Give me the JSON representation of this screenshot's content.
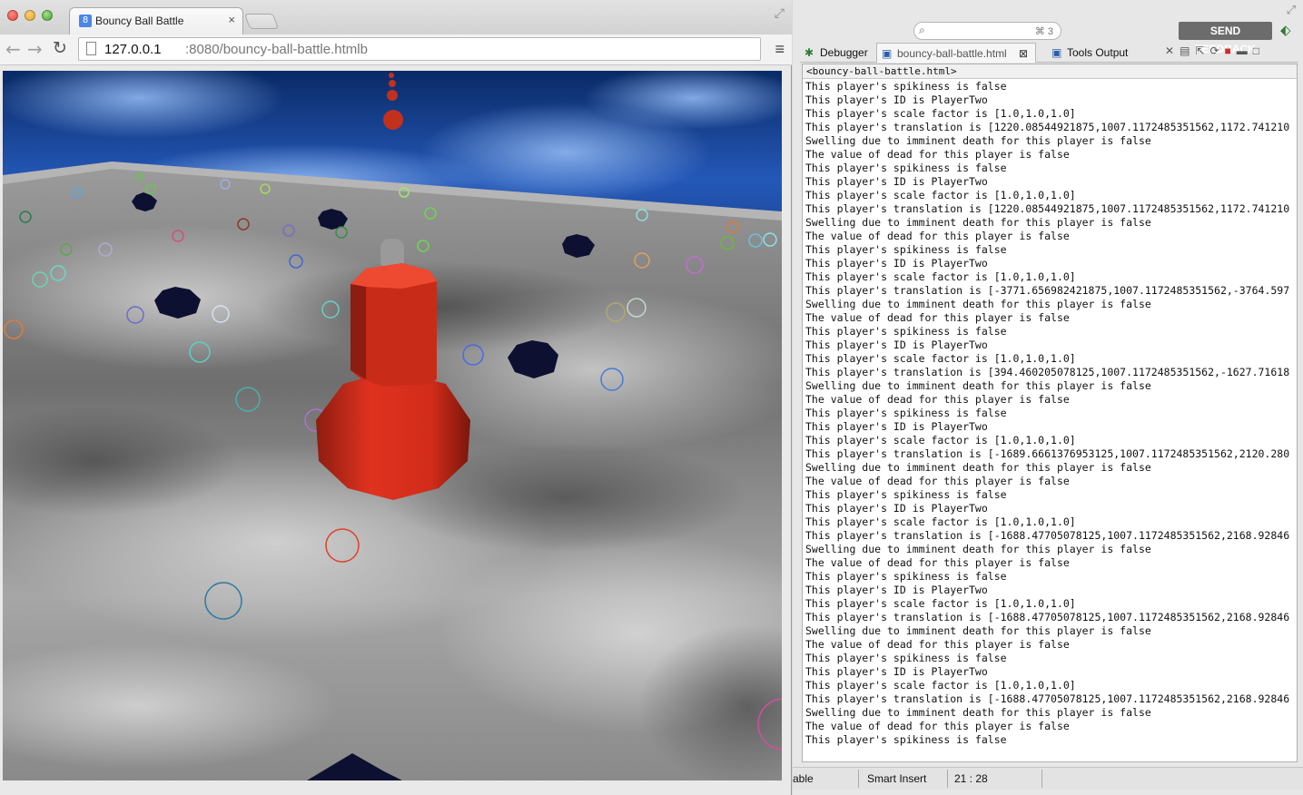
{
  "browser": {
    "tab_title": "Bouncy Ball Battle",
    "tab_favicon": "8",
    "tab_close": "×",
    "url_host": "127.0.0.1",
    "url_path": ":8080/bouncy-ball-battle.htmlb",
    "icons": {
      "back": "←",
      "forward": "→",
      "reload": "↻",
      "menu": "≡",
      "fullscreen": "⤢"
    }
  },
  "ide": {
    "search_placeholder": "",
    "search_hint": "⌘ 3",
    "feedback_label": "SEND FEEDBACK",
    "tabs": [
      {
        "label": "Debugger",
        "icon": "bug-icon"
      },
      {
        "label": "bouncy-ball-battle.html",
        "icon": "file-icon"
      },
      {
        "label": "Tools Output",
        "icon": "console-icon"
      }
    ],
    "editor_tab_close": "⊠",
    "console_header": "<bouncy-ball-battle.html>",
    "console_lines": [
      "This player's spikiness is false",
      "This player's ID is PlayerTwo",
      "This player's scale factor is [1.0,1.0,1.0]",
      "This player's translation is [1220.08544921875,1007.1172485351562,1172.741210",
      "Swelling due to imminent death for this player is false",
      "The value of dead for this player is false",
      "This player's spikiness is false",
      "This player's ID is PlayerTwo",
      "This player's scale factor is [1.0,1.0,1.0]",
      "This player's translation is [1220.08544921875,1007.1172485351562,1172.741210",
      "Swelling due to imminent death for this player is false",
      "The value of dead for this player is false",
      "This player's spikiness is false",
      "This player's ID is PlayerTwo",
      "This player's scale factor is [1.0,1.0,1.0]",
      "This player's translation is [-3771.656982421875,1007.1172485351562,-3764.597",
      "Swelling due to imminent death for this player is false",
      "The value of dead for this player is false",
      "This player's spikiness is false",
      "This player's ID is PlayerTwo",
      "This player's scale factor is [1.0,1.0,1.0]",
      "This player's translation is [394.460205078125,1007.1172485351562,-1627.71618",
      "Swelling due to imminent death for this player is false",
      "The value of dead for this player is false",
      "This player's spikiness is false",
      "This player's ID is PlayerTwo",
      "This player's scale factor is [1.0,1.0,1.0]",
      "This player's translation is [-1689.6661376953125,1007.1172485351562,2120.280",
      "Swelling due to imminent death for this player is false",
      "The value of dead for this player is false",
      "This player's spikiness is false",
      "This player's ID is PlayerTwo",
      "This player's scale factor is [1.0,1.0,1.0]",
      "This player's translation is [-1688.47705078125,1007.1172485351562,2168.92846",
      "Swelling due to imminent death for this player is false",
      "The value of dead for this player is false",
      "This player's spikiness is false",
      "This player's ID is PlayerTwo",
      "This player's scale factor is [1.0,1.0,1.0]",
      "This player's translation is [-1688.47705078125,1007.1172485351562,2168.92846",
      "Swelling due to imminent death for this player is false",
      "The value of dead for this player is false",
      "This player's spikiness is false",
      "This player's ID is PlayerTwo",
      "This player's scale factor is [1.0,1.0,1.0]",
      "This player's translation is [-1688.47705078125,1007.1172485351562,2168.92846",
      "Swelling due to imminent death for this player is false",
      "The value of dead for this player is false",
      "This player's spikiness is false"
    ],
    "status": {
      "left": "able",
      "insert_mode": "Smart Insert",
      "cursor": "21 : 28"
    }
  },
  "game": {
    "colors": {
      "player": "#e0321f",
      "sky": "#1f4fa8",
      "ground": "#8a8a8a",
      "spiky": "#0d1030"
    }
  }
}
